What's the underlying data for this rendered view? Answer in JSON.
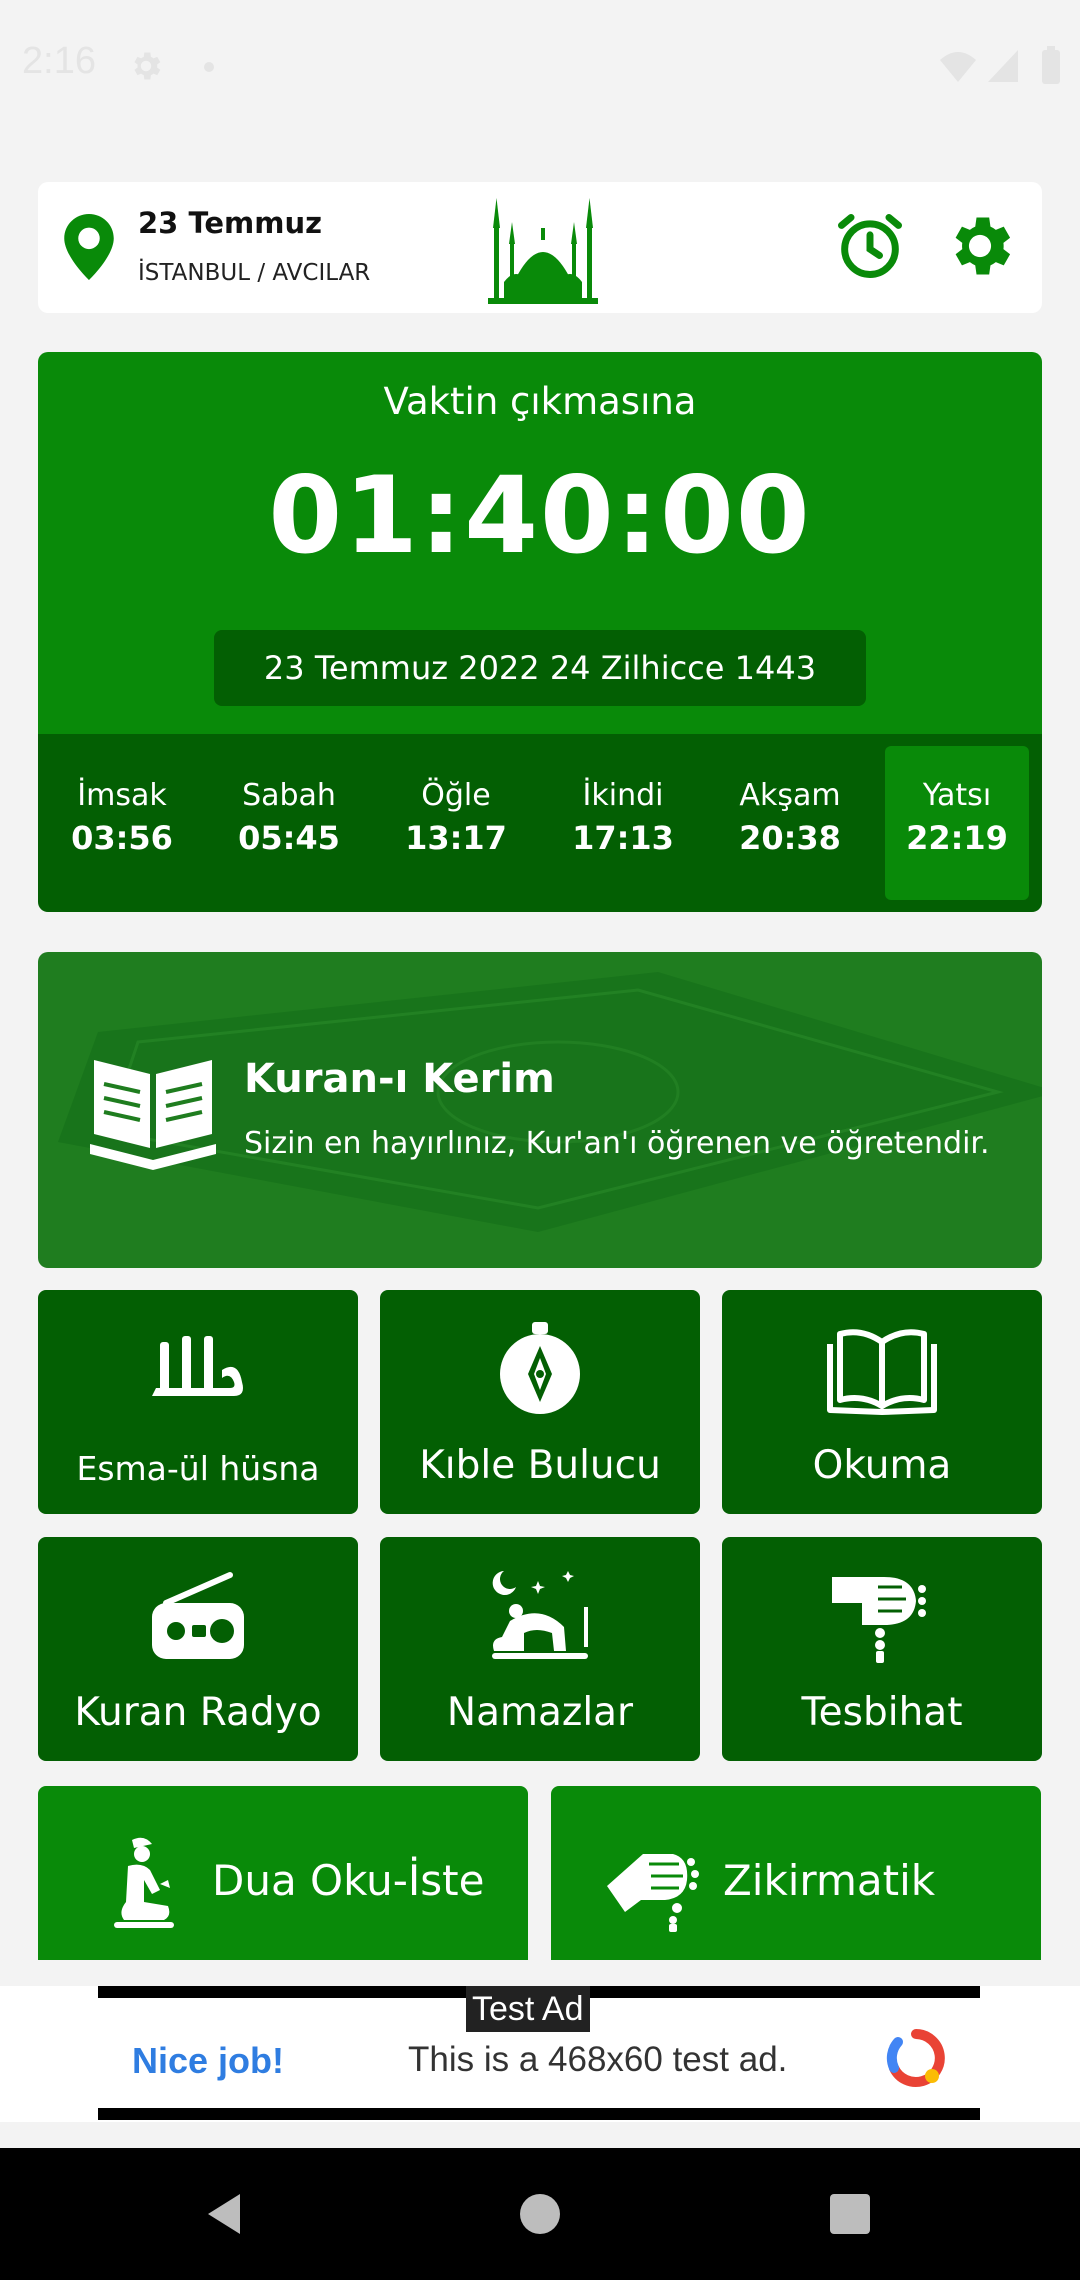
{
  "status_bar": {
    "time": "2:16"
  },
  "header": {
    "date": "23 Temmuz",
    "location": "İSTANBUL / AVCILAR"
  },
  "countdown": {
    "label": "Vaktin çıkmasına",
    "timer": "01:40:00",
    "dates": "23 Temmuz 2022  24 Zilhicce 1443"
  },
  "prayers": [
    {
      "name": "İmsak",
      "time": "03:56"
    },
    {
      "name": "Sabah",
      "time": "05:45"
    },
    {
      "name": "Öğle",
      "time": "13:17"
    },
    {
      "name": "İkindi",
      "time": "17:13"
    },
    {
      "name": "Akşam",
      "time": "20:38"
    },
    {
      "name": "Yatsı",
      "time": "22:19",
      "active": true
    }
  ],
  "kuran_banner": {
    "title": "Kuran-ı Kerim",
    "subtitle": "Sizin en hayırlınız, Kur'an'ı öğrenen ve öğretendir."
  },
  "tiles": [
    {
      "label": "Esma-ül hüsna",
      "icon": "allah-calligraphy-icon"
    },
    {
      "label": "Kıble Bulucu",
      "icon": "compass-icon"
    },
    {
      "label": "Okuma",
      "icon": "open-book-icon"
    },
    {
      "label": "Kuran Radyo",
      "icon": "radio-icon"
    },
    {
      "label": "Namazlar",
      "icon": "prayer-icon"
    },
    {
      "label": "Tesbihat",
      "icon": "prayer-beads-hand-icon"
    }
  ],
  "wide_buttons": [
    {
      "label": "Dua Oku-İste",
      "icon": "praying-person-icon"
    },
    {
      "label": "Zikirmatik",
      "icon": "hand-counter-icon"
    }
  ],
  "ad": {
    "tag": "Test Ad",
    "nice": "Nice job!",
    "text": "This is a 468x60 test ad."
  },
  "colors": {
    "primary_green": "#098a09",
    "dark_green": "#035f03",
    "background": "#f3f3f3"
  }
}
